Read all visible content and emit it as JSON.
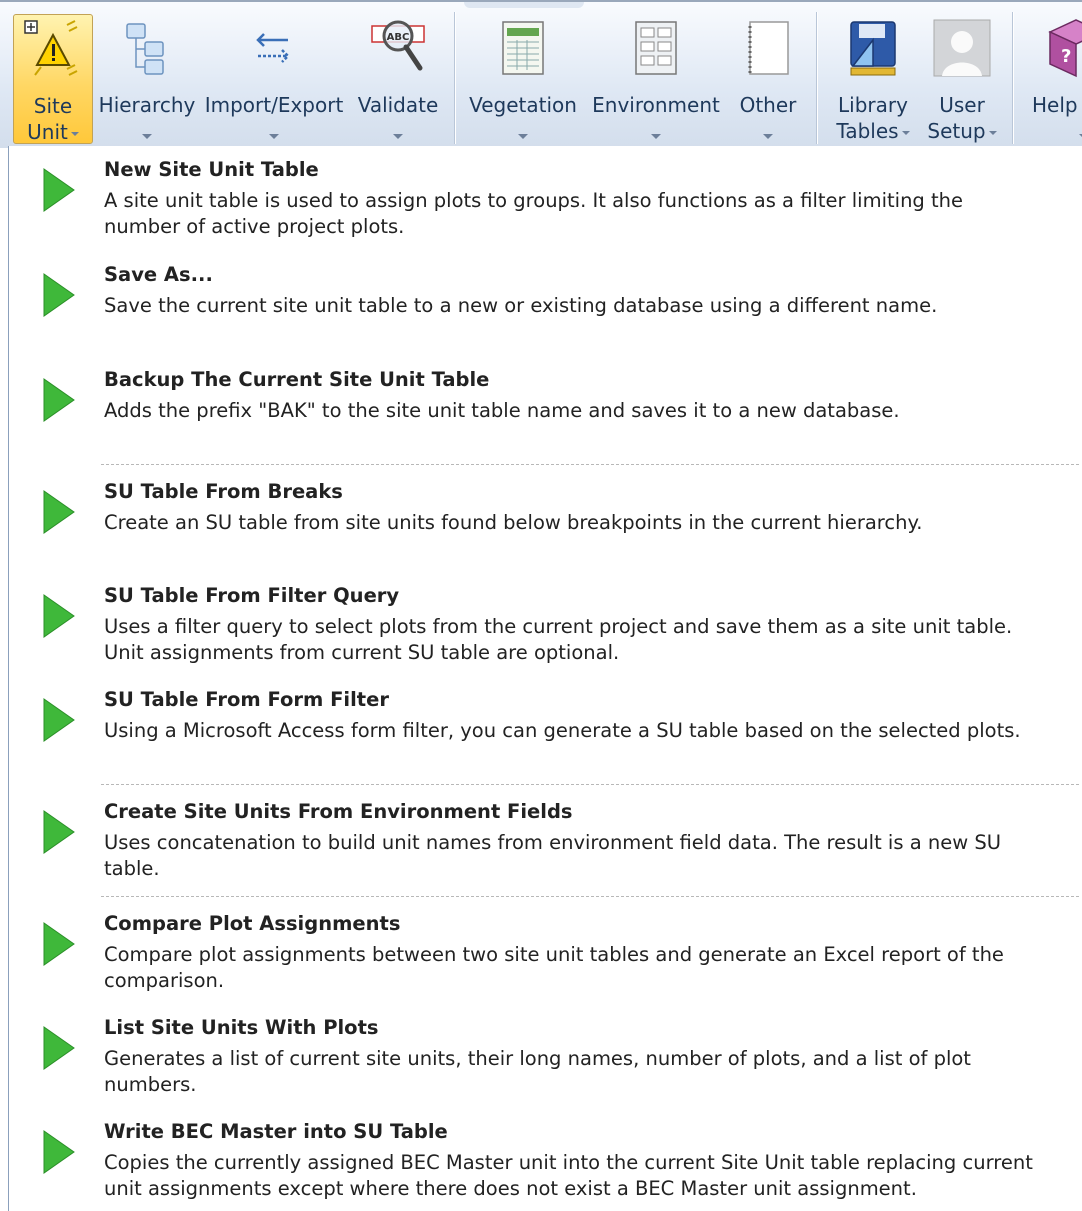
{
  "ribbon": {
    "buttons": [
      {
        "id": "site-unit",
        "line1": "Site",
        "line2": "Unit"
      },
      {
        "id": "hierarchy",
        "line1": "Hierarchy"
      },
      {
        "id": "import-export",
        "line1": "Import/Export"
      },
      {
        "id": "validate",
        "line1": "Validate"
      },
      {
        "id": "vegetation",
        "line1": "Vegetation"
      },
      {
        "id": "environment",
        "line1": "Environment"
      },
      {
        "id": "other",
        "line1": "Other"
      },
      {
        "id": "library-tables",
        "line1": "Library",
        "line2": "Tables"
      },
      {
        "id": "user-setup",
        "line1": "User",
        "line2": "Setup"
      },
      {
        "id": "help",
        "line1": "Help"
      }
    ],
    "validate_icon_text": "ABC"
  },
  "menu": {
    "items": [
      {
        "title": "New Site Unit Table",
        "desc": "A site unit table is used to assign plots to groups.  It also functions as a filter limiting the number of active project plots."
      },
      {
        "title": "Save As...",
        "desc": "Save the current site unit table to a new or existing database using a different name."
      },
      {
        "title": "Backup The Current Site Unit Table",
        "desc": "Adds the prefix \"BAK\" to the site unit table name and saves it to a new database."
      },
      {
        "title": "SU Table From Breaks",
        "desc": "Create an SU table from site units found below breakpoints in the current hierarchy."
      },
      {
        "title": "SU Table From Filter Query",
        "desc": "Uses a filter query to select plots from the current project and save them as a site unit table.  Unit assignments from current SU table are optional."
      },
      {
        "title": "SU Table From Form Filter",
        "desc": "Using a Microsoft Access form filter, you can generate a SU table based on the selected plots."
      },
      {
        "title": "Create Site Units From Environment Fields",
        "desc": "Uses concatenation to build unit names from environment field data.  The result is a new SU table."
      },
      {
        "title": "Compare Plot Assignments",
        "desc": "Compare plot assignments between two site unit tables and generate an Excel report of the comparison."
      },
      {
        "title": "List Site Units With Plots",
        "desc": "Generates a list of current site units, their long names, number of plots, and a list of plot numbers."
      },
      {
        "title": "Write BEC Master into SU Table",
        "desc": "Copies the currently assigned BEC Master unit into the current Site Unit table replacing current unit assignments except where there does not exist a BEC Master unit assignment."
      }
    ]
  },
  "colors": {
    "accent_active": "#ffd764",
    "arrow_green": "#3fb83a",
    "ribbon_text": "#1e395b"
  }
}
